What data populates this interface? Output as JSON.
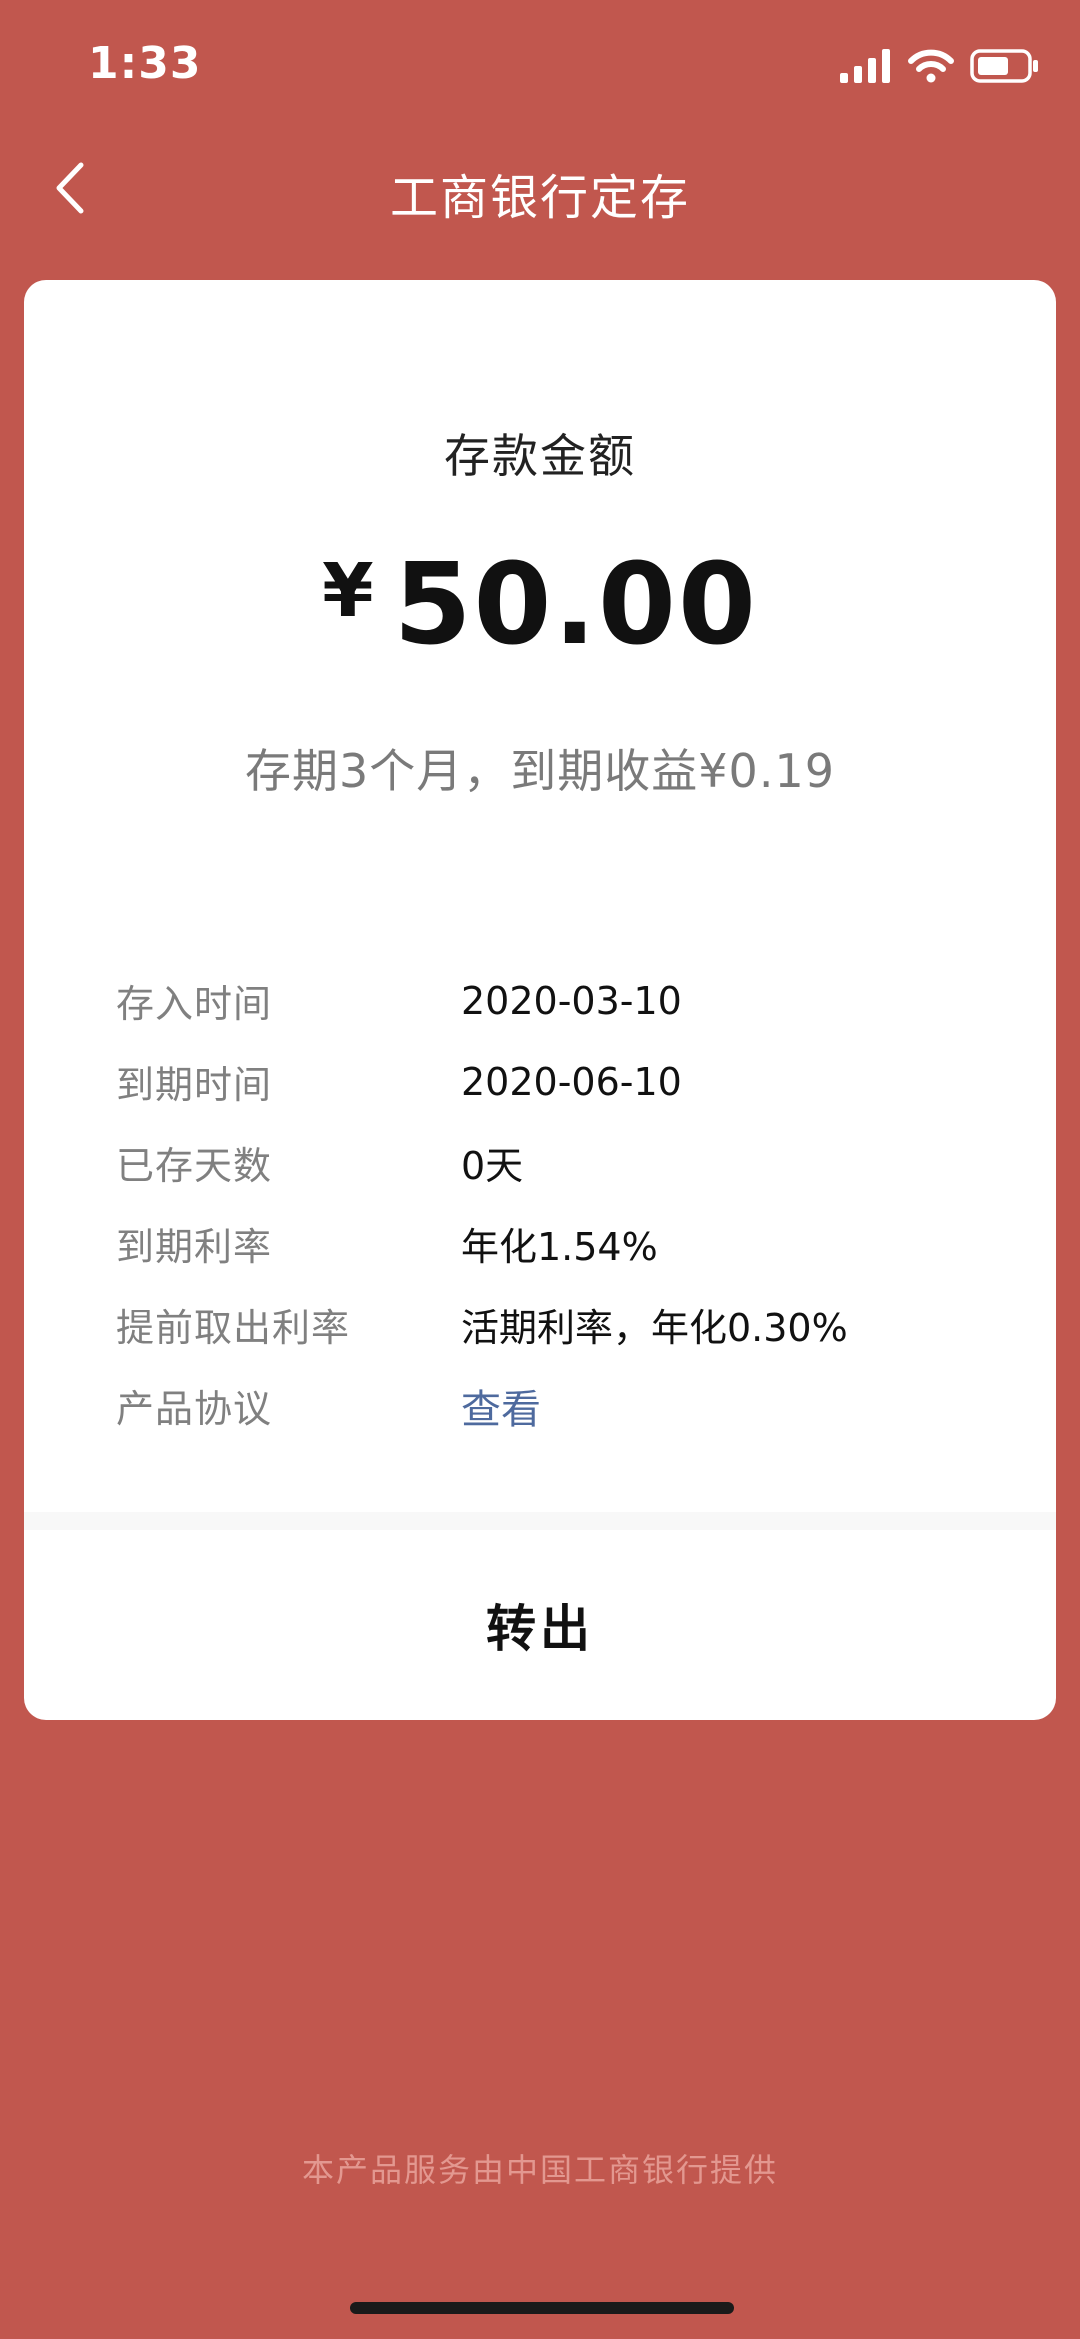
{
  "status_bar": {
    "time": "1:33",
    "signal_icon": "cellular-signal-icon",
    "wifi_icon": "wifi-icon",
    "battery_icon": "battery-icon"
  },
  "nav": {
    "back_icon": "chevron-left-icon",
    "title": "工商银行定存"
  },
  "deposit": {
    "amount_label": "存款金额",
    "currency_symbol": "¥",
    "amount": "50.00",
    "term_summary": "存期3个月，到期收益¥0.19"
  },
  "details": [
    {
      "label": "存入时间",
      "value": "2020-03-10"
    },
    {
      "label": "到期时间",
      "value": "2020-06-10"
    },
    {
      "label": "已存天数",
      "value": "0天"
    },
    {
      "label": "到期利率",
      "value": "年化1.54%"
    },
    {
      "label": "提前取出利率",
      "value": "活期利率，年化0.30%"
    },
    {
      "label": "产品协议",
      "value": "查看"
    }
  ],
  "actions": {
    "transfer_out": "转出"
  },
  "footer": {
    "text": "本产品服务由中国工商银行提供"
  },
  "colors": {
    "background": "#c1574e",
    "card": "#ffffff",
    "link": "#4e6a9e"
  }
}
